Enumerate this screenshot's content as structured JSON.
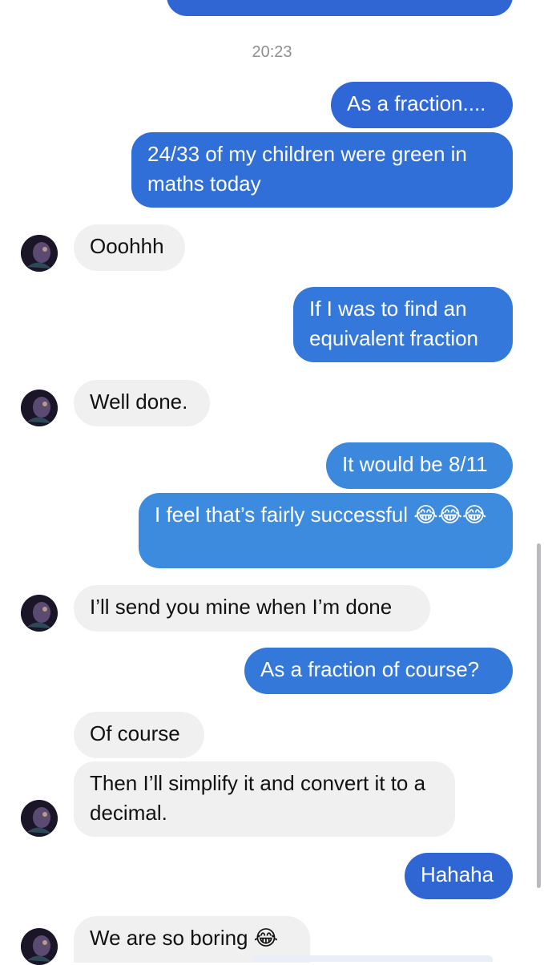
{
  "colors": {
    "outgoing_top": "#2f66d4",
    "outgoing_mid": "#3d86dc",
    "outgoing_bottom": "#2f66d4",
    "incoming": "#f0f0f0"
  },
  "conversation": {
    "timestamp": "20:23",
    "messages": [
      {
        "id": "m1",
        "side": "out",
        "text": "As a fraction...."
      },
      {
        "id": "m2",
        "side": "out",
        "text": "24/33 of my children were green in maths today"
      },
      {
        "id": "m3",
        "side": "in",
        "text": "Ooohhh"
      },
      {
        "id": "m4",
        "side": "out",
        "text": "If I was to find an equivalent fraction"
      },
      {
        "id": "m5",
        "side": "in",
        "text": "Well done."
      },
      {
        "id": "m6",
        "side": "out",
        "text": "It would be 8/11"
      },
      {
        "id": "m7",
        "side": "out",
        "text": "I feel that’s fairly successful 😂😂😂"
      },
      {
        "id": "m8",
        "side": "in",
        "text": "I’ll send you mine when I’m done"
      },
      {
        "id": "m9",
        "side": "out",
        "text": "As a fraction of course?"
      },
      {
        "id": "m10",
        "side": "in",
        "text": "Of course"
      },
      {
        "id": "m11",
        "side": "in",
        "text": "Then I’ll simplify it and convert it to a decimal."
      },
      {
        "id": "m12",
        "side": "out",
        "text": "Hahaha"
      },
      {
        "id": "m13",
        "side": "in",
        "text": "We are so boring 😂"
      }
    ]
  }
}
